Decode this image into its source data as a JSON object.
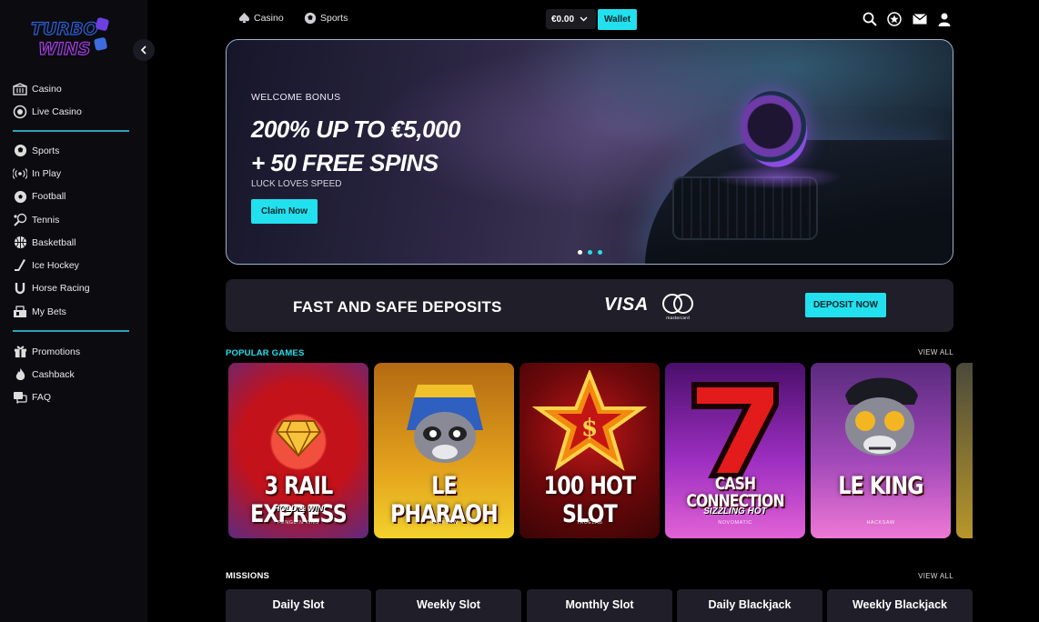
{
  "brand": {
    "logo_line1": "TURBO",
    "logo_line2": "WINS"
  },
  "sidebar": {
    "groups": [
      [
        {
          "label": "Casino",
          "icon": "casino-icon"
        },
        {
          "label": "Live Casino",
          "icon": "live-casino-icon"
        }
      ],
      [
        {
          "label": "Sports",
          "icon": "soccer-ball-icon"
        },
        {
          "label": "In Play",
          "icon": "broadcast-icon"
        },
        {
          "label": "Football",
          "icon": "football-icon"
        },
        {
          "label": "Tennis",
          "icon": "tennis-icon"
        },
        {
          "label": "Basketball",
          "icon": "basketball-icon"
        },
        {
          "label": "Ice Hockey",
          "icon": "hockey-stick-icon"
        },
        {
          "label": "Horse Racing",
          "icon": "horseshoe-icon"
        },
        {
          "label": "My Bets",
          "icon": "bets-icon"
        }
      ],
      [
        {
          "label": "Promotions",
          "icon": "gift-icon"
        },
        {
          "label": "Cashback",
          "icon": "flame-icon"
        },
        {
          "label": "FAQ",
          "icon": "chat-icon"
        }
      ]
    ]
  },
  "topbar": {
    "casino": "Casino",
    "sports": "Sports",
    "balance": "€0.00",
    "wallet": "Wallet"
  },
  "banner": {
    "kicker": "WELCOME BONUS",
    "headline1": "200% UP TO €5,000",
    "headline2": "+ 50 FREE SPINS",
    "sub": "LUCK LOVES SPEED",
    "cta": "Claim Now",
    "slides": 3,
    "active_slide": 3
  },
  "deposits": {
    "title": "FAST AND SAFE DEPOSITS",
    "visa": "VISA",
    "mastercard": "mastercard",
    "cta": "DEPOSIT NOW"
  },
  "popular": {
    "title": "POPULAR GAMES",
    "view_all": "VIEW ALL",
    "games": [
      {
        "name": "3 RAIL EXPRESS",
        "tag": "HOLD & WIN",
        "provider": "PENGUIN KING",
        "bg": "#b8141c",
        "bg2": "#e0302a"
      },
      {
        "name": "LE PHARAOH",
        "tag": "",
        "provider": "HACKSAW",
        "bg": "#d88a13",
        "bg2": "#f4c92a"
      },
      {
        "name": "100 HOT SLOT",
        "tag": "",
        "provider": "TRUELAB",
        "bg": "#4b0709",
        "bg2": "#a10f12"
      },
      {
        "name": "CASH CONNECTION",
        "tag": "SIZZLING HOT",
        "provider": "NOVOMATIC",
        "bg": "#7a1f9e",
        "bg2": "#c84ad8"
      },
      {
        "name": "LE KING",
        "tag": "",
        "provider": "HACKSAW",
        "bg": "#7f2f93",
        "bg2": "#e06ad0"
      }
    ]
  },
  "missions": {
    "title": "MISSIONS",
    "view_all": "VIEW ALL",
    "items": [
      "Daily Slot",
      "Weekly Slot",
      "Monthly Slot",
      "Daily Blackjack",
      "Weekly Blackjack"
    ]
  },
  "colors": {
    "accent": "#22e0ee",
    "panel": "#1f1e29",
    "sidebar": "#0b0b10"
  }
}
